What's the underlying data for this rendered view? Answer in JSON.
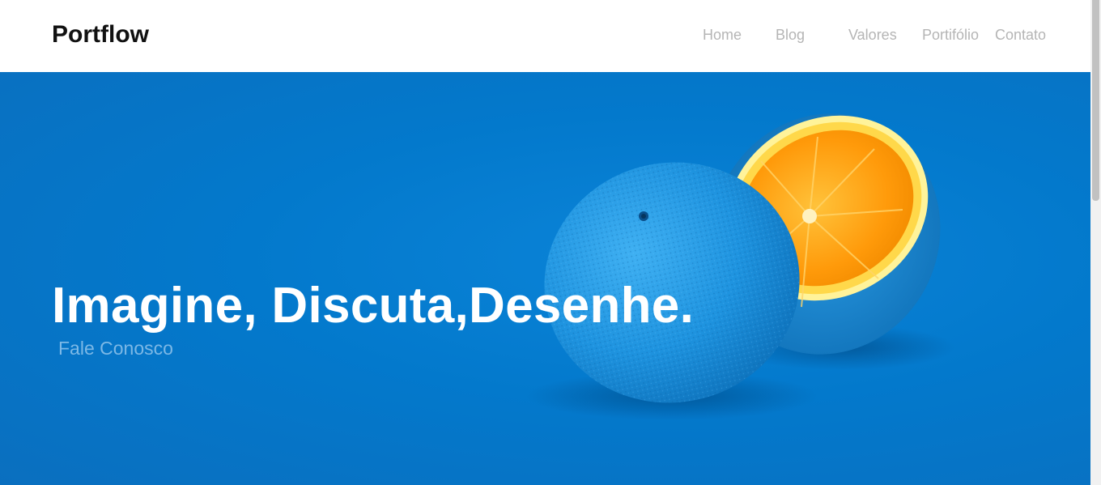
{
  "brand": {
    "name": "Portflow"
  },
  "nav": {
    "items": [
      {
        "label": "Home"
      },
      {
        "label": "Blog"
      },
      {
        "label": "Valores"
      },
      {
        "label": "Portifólio"
      },
      {
        "label": "Contato"
      }
    ]
  },
  "hero": {
    "headline": "Imagine, Discuta,Desenhe.",
    "cta_label": "Fale Conosco",
    "image_subject": "blue-painted-orange-cut-half",
    "colors": {
      "background": "#0379cc",
      "orange_flesh": "#ff9a0a",
      "rind_blue": "#1e93df"
    }
  },
  "colors": {
    "nav_text": "#b5b5b5",
    "brand_text": "#111111",
    "headline_text": "#ffffff",
    "cta_text": "#7cb8e6"
  }
}
